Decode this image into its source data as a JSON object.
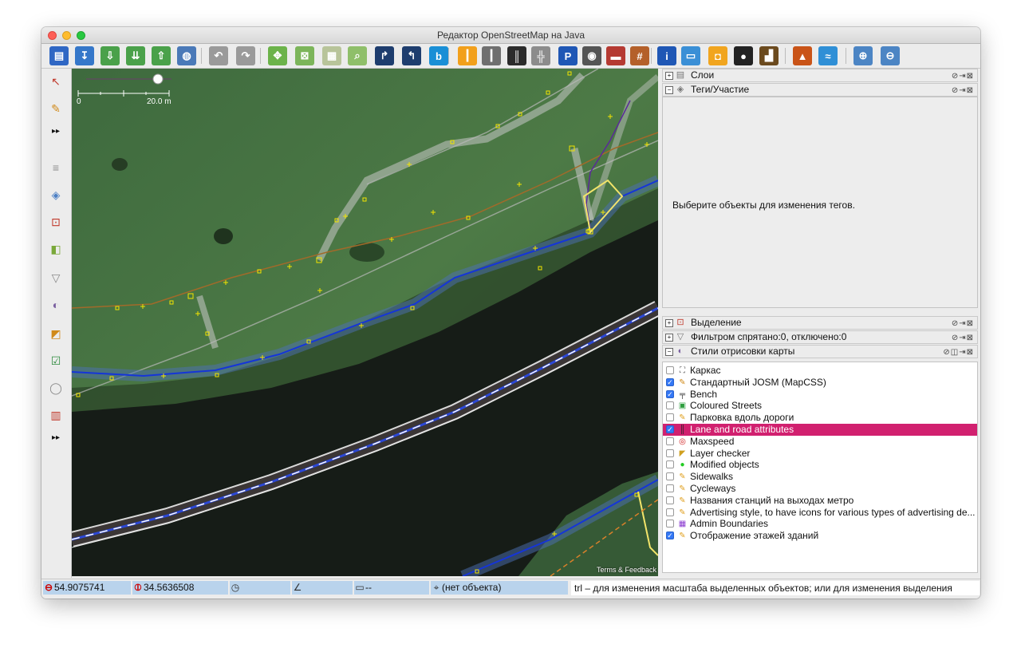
{
  "window": {
    "title": "Редактор OpenStreetMap на Java"
  },
  "toolbar": {
    "buttons": [
      {
        "name": "open-file-button",
        "icon": "folder-icon",
        "color": "#2f67c4",
        "glyph": "▤"
      },
      {
        "name": "save-button",
        "icon": "save-icon",
        "color": "#3577c9",
        "glyph": "↧"
      },
      {
        "name": "download-button",
        "icon": "download-icon",
        "color": "#4aa14a",
        "glyph": "⇩"
      },
      {
        "name": "download-in-view-button",
        "icon": "download-view-icon",
        "color": "#4aa14a",
        "glyph": "⇊"
      },
      {
        "name": "upload-button",
        "icon": "upload-icon",
        "color": "#4aa14a",
        "glyph": "⇧"
      },
      {
        "name": "preferences-globe-button",
        "icon": "globe-icon",
        "color": "#4a79b8",
        "glyph": "◍"
      },
      {
        "name": "undo-button",
        "icon": "undo-icon",
        "color": "#9a9a9a",
        "glyph": "↶"
      },
      {
        "name": "redo-button",
        "icon": "redo-icon",
        "color": "#9a9a9a",
        "glyph": "↷"
      },
      {
        "name": "zoom-to-data-button",
        "icon": "zoom-data-icon",
        "color": "#6cb34a",
        "glyph": "✥"
      },
      {
        "name": "zoom-to-selection-button",
        "icon": "zoom-selection-icon",
        "color": "#7cb55a",
        "glyph": "⊠"
      },
      {
        "name": "zoom-to-layer-button",
        "icon": "zoom-layer-icon",
        "color": "#b8c49a",
        "glyph": "▦"
      },
      {
        "name": "search-button",
        "icon": "magnifier-icon",
        "color": "#8fbf6a",
        "glyph": "⌕"
      },
      {
        "name": "turn-restriction-button",
        "icon": "turn-icon",
        "color": "#1e3d6e",
        "glyph": "↱"
      },
      {
        "name": "turn-restriction-2-button",
        "icon": "turn-alt-icon",
        "color": "#1e3d6e",
        "glyph": "↰"
      },
      {
        "name": "bing-imagery-button",
        "icon": "bing-icon",
        "color": "#1a8fd6",
        "glyph": "b"
      },
      {
        "name": "road-preset-button",
        "icon": "road-icon",
        "color": "#f2a01c",
        "glyph": "┃"
      },
      {
        "name": "track-preset-button",
        "icon": "track-icon",
        "color": "#6f6f6f",
        "glyph": "┃"
      },
      {
        "name": "lanes-preset-button",
        "icon": "lanes-icon",
        "color": "#2b2b2b",
        "glyph": "║"
      },
      {
        "name": "crossing-preset-button",
        "icon": "crossing-icon",
        "color": "#8c8c8c",
        "glyph": "╬"
      },
      {
        "name": "parking-preset-button",
        "icon": "parking-icon",
        "color": "#1f57b5",
        "glyph": "P"
      },
      {
        "name": "traffic-signal-button",
        "icon": "traffic-light-icon",
        "color": "#555555",
        "glyph": "◉"
      },
      {
        "name": "barrier-preset-button",
        "icon": "wall-icon",
        "color": "#b53a32",
        "glyph": "▬"
      },
      {
        "name": "railway-preset-button",
        "icon": "railway-icon",
        "color": "#b4602a",
        "glyph": "#"
      },
      {
        "name": "info-preset-button",
        "icon": "info-icon",
        "color": "#1f57b5",
        "glyph": "i"
      },
      {
        "name": "accommodation-preset-button",
        "icon": "bed-icon",
        "color": "#3a8fd6",
        "glyph": "▭"
      },
      {
        "name": "shop-preset-button",
        "icon": "shopping-bag-icon",
        "color": "#f1a51f",
        "glyph": "◘"
      },
      {
        "name": "sport-preset-button",
        "icon": "football-icon",
        "color": "#222222",
        "glyph": "●"
      },
      {
        "name": "industrial-preset-button",
        "icon": "factory-icon",
        "color": "#6b4a1e",
        "glyph": "▟"
      },
      {
        "name": "peak-preset-button",
        "icon": "peak-icon",
        "color": "#c95418",
        "glyph": "▲"
      },
      {
        "name": "waterway-preset-button",
        "icon": "river-icon",
        "color": "#2f8fd6",
        "glyph": "≈"
      },
      {
        "name": "zoom-in-button",
        "icon": "zoom-in-icon",
        "color": "#4c85c4",
        "glyph": "⊕"
      },
      {
        "name": "zoom-out-button",
        "icon": "zoom-out-icon",
        "color": "#4c85c4",
        "glyph": "⊖"
      }
    ]
  },
  "lefttoolbar": {
    "tools": [
      {
        "name": "select-tool",
        "icon": "select-arrow-icon",
        "glyph": "↖",
        "color": "#c0392b"
      },
      {
        "name": "draw-tool",
        "icon": "pencil-icon",
        "glyph": "✎",
        "color": "#d08a1a"
      },
      {
        "name": "more-tools-button",
        "icon": "double-arrow-icon",
        "glyph": "▸▸",
        "color": "#111111"
      },
      {
        "name": "layers-toggle",
        "icon": "layers-icon",
        "glyph": "≡",
        "color": "#8a8a8a"
      },
      {
        "name": "tags-toggle",
        "icon": "tag-icon",
        "glyph": "◈",
        "color": "#4c7fc4"
      },
      {
        "name": "selection-toggle",
        "icon": "selection-icon",
        "glyph": "⊡",
        "color": "#c0392b"
      },
      {
        "name": "imagery-toggle",
        "icon": "imagery-icon",
        "glyph": "◧",
        "color": "#7aa83a"
      },
      {
        "name": "filter-toggle",
        "icon": "filter-icon",
        "glyph": "▽",
        "color": "#8a8a8a"
      },
      {
        "name": "map-style-toggle",
        "icon": "palette-icon",
        "glyph": "◐",
        "color": "#7a5fa0"
      },
      {
        "name": "history-toggle",
        "icon": "history-icon",
        "glyph": "◩",
        "color": "#d08a1a"
      },
      {
        "name": "validator-toggle",
        "icon": "checklist-icon",
        "glyph": "☑",
        "color": "#2e8b3e"
      },
      {
        "name": "wiki-toggle",
        "icon": "wikipedia-icon",
        "glyph": "◯",
        "color": "#8a8a8a"
      },
      {
        "name": "barcode-toggle",
        "icon": "barcode-icon",
        "glyph": "▥",
        "color": "#c0392b"
      },
      {
        "name": "more-toggles-button",
        "icon": "double-arrow-icon",
        "glyph": "▸▸",
        "color": "#111111"
      }
    ]
  },
  "map": {
    "scale_zero": "0",
    "scale_label": "20.0 m",
    "terms": "Terms & Feedback"
  },
  "panels": {
    "layers": "Слои",
    "tags": "Теги/Участие",
    "tags_empty": "Выберите объекты для изменения тегов.",
    "selection": "Выделение",
    "filter": "Фильтром спрятано:0, отключено:0",
    "map_styles": "Стили отрисовки карты"
  },
  "styles": [
    {
      "label": "Каркас",
      "checked": false,
      "selected": false,
      "icon": "wireframe-icon",
      "glyph": "⛶",
      "color": "#555555"
    },
    {
      "label": "Стандартный JOSM (MapCSS)",
      "checked": true,
      "selected": false,
      "icon": "josm-icon",
      "glyph": "✎",
      "color": "#d08a1a"
    },
    {
      "label": "Bench",
      "checked": true,
      "selected": false,
      "icon": "bench-icon",
      "glyph": "╤",
      "color": "#333333"
    },
    {
      "label": "Coloured Streets",
      "checked": false,
      "selected": false,
      "icon": "coloured-streets-icon",
      "glyph": "▣",
      "color": "#2e9e3e"
    },
    {
      "label": "Парковка вдоль дороги",
      "checked": false,
      "selected": false,
      "icon": "pencil-icon",
      "glyph": "✎",
      "color": "#e0a020"
    },
    {
      "label": "Lane and road attributes",
      "checked": true,
      "selected": true,
      "icon": "lanes-icon",
      "glyph": "║",
      "color": "#222222"
    },
    {
      "label": "Maxspeed",
      "checked": false,
      "selected": false,
      "icon": "maxspeed-icon",
      "glyph": "◎",
      "color": "#d02020"
    },
    {
      "label": "Layer checker",
      "checked": false,
      "selected": false,
      "icon": "layer-checker-icon",
      "glyph": "◤",
      "color": "#d0a020"
    },
    {
      "label": "Modified objects",
      "checked": false,
      "selected": false,
      "icon": "green-dot-icon",
      "glyph": "●",
      "color": "#22cc22"
    },
    {
      "label": "Sidewalks",
      "checked": false,
      "selected": false,
      "icon": "pencil-icon",
      "glyph": "✎",
      "color": "#e0a020"
    },
    {
      "label": "Cycleways",
      "checked": false,
      "selected": false,
      "icon": "pencil-icon",
      "glyph": "✎",
      "color": "#e0a020"
    },
    {
      "label": "Названия станций на выходах метро",
      "checked": false,
      "selected": false,
      "icon": "pencil-icon",
      "glyph": "✎",
      "color": "#e0a020"
    },
    {
      "label": "Advertising style, to have icons for various types of advertising de...",
      "checked": false,
      "selected": false,
      "icon": "pencil-icon",
      "glyph": "✎",
      "color": "#e0a020"
    },
    {
      "label": "Admin Boundaries",
      "checked": false,
      "selected": false,
      "icon": "admin-boundaries-icon",
      "glyph": "▦",
      "color": "#8a3ad0"
    },
    {
      "label": "Отображение этажей зданий",
      "checked": true,
      "selected": false,
      "icon": "pencil-icon",
      "glyph": "✎",
      "color": "#e0a020"
    }
  ],
  "status": {
    "lat": "54.9075741",
    "lon": "34.5636508",
    "heading": "",
    "angle": "",
    "distance": "--",
    "object": "(нет объекта)",
    "hint": "trl – для изменения масштаба выделенных объектов; или для изменения выделения"
  }
}
